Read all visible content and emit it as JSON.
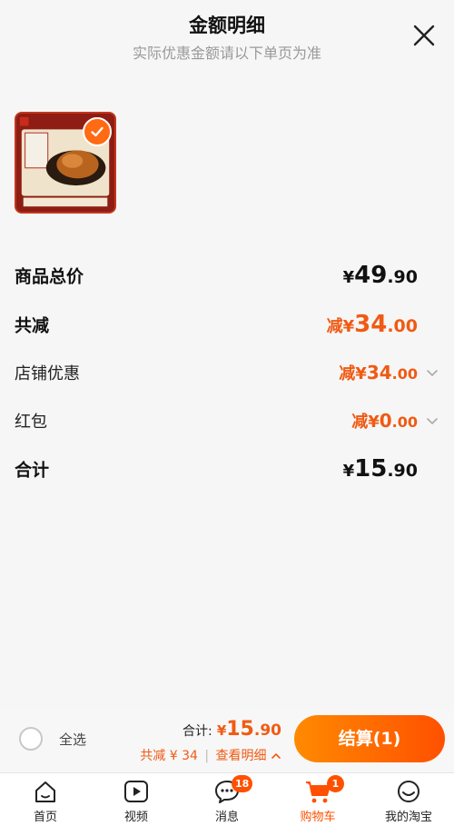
{
  "header": {
    "title": "金额明细",
    "subtitle": "实际优惠金额请以下单页为准"
  },
  "summary": {
    "subtotal": {
      "label": "商品总价",
      "currency": "¥",
      "int": "49",
      "dec": ".90"
    },
    "total_discount": {
      "label": "共减",
      "prefix": "减¥",
      "int": "34",
      "dec": ".00"
    },
    "shop_discount": {
      "label": "店铺优惠",
      "prefix": "减¥",
      "int": "34",
      "dec": ".00"
    },
    "red_packet": {
      "label": "红包",
      "prefix": "减¥",
      "int": "0",
      "dec": ".00"
    },
    "total": {
      "label": "合计",
      "currency": "¥",
      "int": "15",
      "dec": ".90"
    }
  },
  "bottom_bar": {
    "select_all_label": "全选",
    "total_label": "合计:",
    "total_currency": "¥",
    "total_int": "15",
    "total_dec": ".90",
    "discount_text": "共减 ¥ 34",
    "separator": "|",
    "detail_link": "查看明细",
    "checkout_label": "结算(1)"
  },
  "tabbar": {
    "tabs": [
      {
        "label": "首页",
        "icon": "home-icon"
      },
      {
        "label": "视频",
        "icon": "video-icon"
      },
      {
        "label": "消息",
        "icon": "message-icon",
        "badge": "18"
      },
      {
        "label": "购物车",
        "icon": "cart-icon",
        "badge": "1",
        "active": true
      },
      {
        "label": "我的淘宝",
        "icon": "profile-icon"
      }
    ]
  },
  "colors": {
    "accent": "#ff5000",
    "price_orange": "#f05a13"
  }
}
